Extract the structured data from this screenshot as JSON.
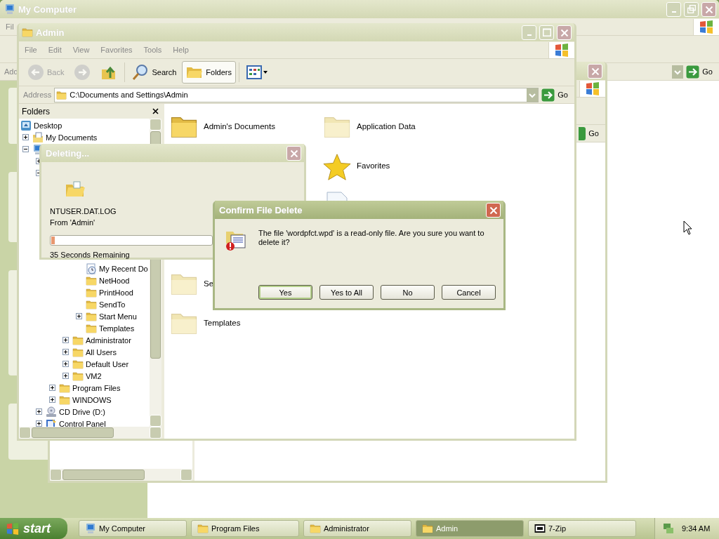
{
  "my_computer": {
    "title": "My Computer",
    "menu": [
      "Fil"
    ],
    "address_label": "Add",
    "go": "Go"
  },
  "background_window": {
    "go": "Go"
  },
  "admin": {
    "title": "Admin",
    "menu": [
      "File",
      "Edit",
      "View",
      "Favorites",
      "Tools",
      "Help"
    ],
    "toolbar": [
      {
        "kind": "back",
        "label": "Back",
        "disabled": true,
        "selected": false
      },
      {
        "kind": "forward",
        "disabled": true,
        "selected": false
      },
      {
        "kind": "up",
        "disabled": false,
        "selected": false
      },
      {
        "kind": "search",
        "label": "Search",
        "disabled": false,
        "selected": false
      },
      {
        "kind": "folders",
        "label": "Folders",
        "disabled": false,
        "selected": true
      },
      {
        "kind": "views",
        "disabled": false,
        "selected": false
      }
    ],
    "address": {
      "label": "Address",
      "value": "C:\\Documents and Settings\\Admin",
      "go": "Go"
    },
    "folders_title": "Folders",
    "tree": [
      {
        "label": "Desktop",
        "kind": "desktop",
        "children": [
          {
            "label": "My Documents",
            "kind": "documents",
            "expanded": false
          },
          {
            "kind": "computer",
            "expanded": true,
            "children": [
              {
                "expanded": false
              },
              {
                "expanded": true,
                "children": [
                  {
                    "children": [
                      {
                        "children": [
                          {
                            "label": "My Recent Do",
                            "kind": "recent"
                          },
                          {
                            "label": "NetHood",
                            "kind": "folder"
                          },
                          {
                            "label": "PrintHood",
                            "kind": "folder"
                          },
                          {
                            "label": "SendTo",
                            "kind": "folder"
                          },
                          {
                            "label": "Start Menu",
                            "kind": "folder",
                            "expanded": false
                          },
                          {
                            "label": "Templates",
                            "kind": "folder"
                          }
                        ]
                      },
                      {
                        "label": "Administrator",
                        "kind": "folder",
                        "expanded": false
                      },
                      {
                        "label": "All Users",
                        "kind": "folder",
                        "expanded": false
                      },
                      {
                        "label": "Default User",
                        "kind": "folder",
                        "expanded": false
                      },
                      {
                        "label": "VM2",
                        "kind": "folder",
                        "expanded": false
                      }
                    ]
                  },
                  {
                    "label": "Program Files",
                    "kind": "folder",
                    "expanded": false
                  },
                  {
                    "label": "WINDOWS",
                    "kind": "folder",
                    "expanded": false
                  }
                ]
              },
              {
                "label": "CD Drive (D:)",
                "kind": "cd",
                "expanded": false
              },
              {
                "label": "Control Panel",
                "kind": "control",
                "expanded": false
              }
            ]
          }
        ]
      }
    ],
    "files": [
      {
        "label": "Admin's Documents",
        "kind": "folder",
        "faded": false
      },
      {
        "label": "Application Data",
        "kind": "folder",
        "faded": true
      },
      {
        "label": "Favorites",
        "kind": "star"
      },
      {
        "kind": "recent"
      },
      {
        "label": "Se",
        "kind": "folder",
        "faded": true
      },
      {
        "label": "Templates",
        "kind": "folder",
        "faded": true
      }
    ]
  },
  "deleting": {
    "title": "Deleting...",
    "file": "NTUSER.DAT.LOG",
    "from": "From 'Admin'",
    "level": 0.02,
    "remaining": "35 Seconds Remaining"
  },
  "confirm": {
    "title": "Confirm File Delete",
    "message": "The file 'wordpfct.wpd' is a read-only file. Are you sure you want to delete it?",
    "buttons": [
      {
        "label": "Yes",
        "selected": true
      },
      {
        "label": "Yes to All",
        "selected": false
      },
      {
        "label": "No",
        "selected": false
      },
      {
        "label": "Cancel",
        "selected": false
      }
    ]
  },
  "taskbar": {
    "start": "start",
    "tasks": [
      {
        "label": "My Computer",
        "kind": "computer",
        "selected": false
      },
      {
        "label": "Program Files",
        "kind": "folder",
        "selected": false
      },
      {
        "label": "Administrator",
        "kind": "folder",
        "selected": false
      },
      {
        "label": "Admin",
        "kind": "folder",
        "selected": true
      },
      {
        "label": "7-Zip",
        "kind": "archive",
        "selected": false
      }
    ],
    "clock": "9:34 AM"
  }
}
